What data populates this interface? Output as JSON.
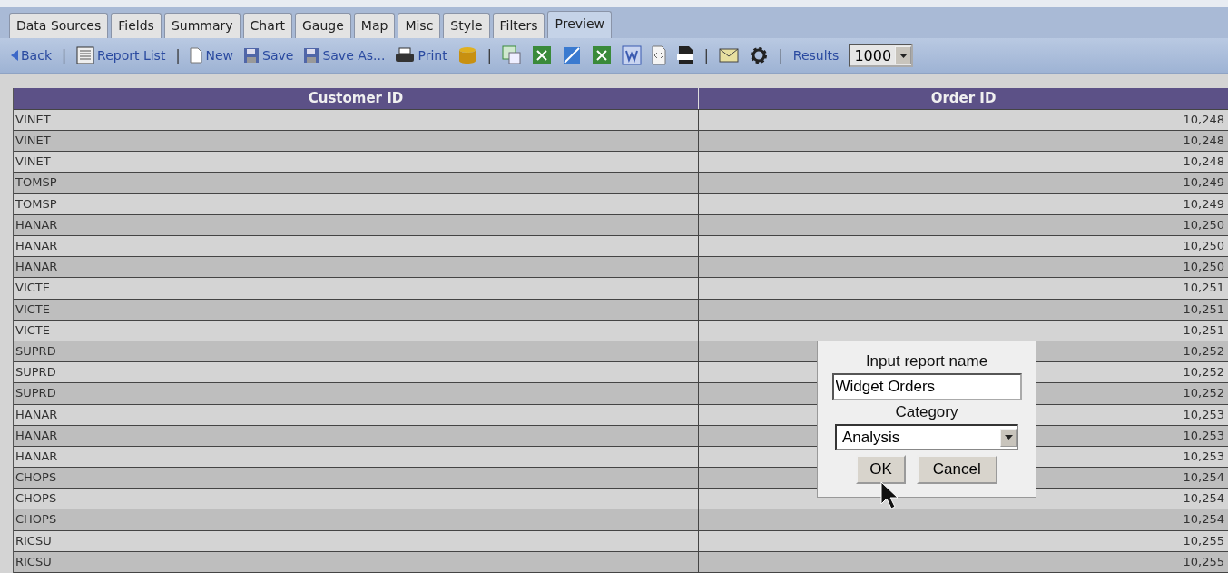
{
  "tabs": [
    {
      "label": "Data Sources",
      "selected": false
    },
    {
      "label": "Fields",
      "selected": false
    },
    {
      "label": "Summary",
      "selected": false
    },
    {
      "label": "Chart",
      "selected": false
    },
    {
      "label": "Gauge",
      "selected": false
    },
    {
      "label": "Map",
      "selected": false
    },
    {
      "label": "Misc",
      "selected": false
    },
    {
      "label": "Style",
      "selected": false
    },
    {
      "label": "Filters",
      "selected": false
    },
    {
      "label": "Preview",
      "selected": true
    }
  ],
  "toolbar": [
    {
      "kind": "text-button",
      "label": "Back"
    },
    {
      "kind": "separator",
      "label": "|"
    },
    {
      "kind": "text-button",
      "label": "Report List"
    },
    {
      "kind": "separator",
      "label": "|"
    },
    {
      "kind": "text-button",
      "label": "New"
    },
    {
      "kind": "text-button",
      "label": "Save"
    },
    {
      "kind": "text-button",
      "label": "Save As..."
    },
    {
      "kind": "text-button",
      "label": "Print"
    },
    {
      "kind": "icon-button"
    },
    {
      "kind": "separator",
      "label": "|"
    },
    {
      "kind": "icon-button"
    },
    {
      "kind": "icon-button"
    },
    {
      "kind": "icon-button"
    },
    {
      "kind": "icon-button"
    },
    {
      "kind": "icon-button"
    },
    {
      "kind": "icon-button"
    },
    {
      "kind": "icon-button"
    },
    {
      "kind": "separator",
      "label": "|"
    },
    {
      "kind": "icon-button"
    },
    {
      "kind": "icon-button"
    },
    {
      "kind": "separator",
      "label": "|"
    }
  ],
  "results": {
    "label": "Results",
    "value": "1000"
  },
  "table": {
    "columns": [
      "Customer ID",
      "Order ID"
    ],
    "rows": [
      [
        "VINET",
        "10,248"
      ],
      [
        "VINET",
        "10,248"
      ],
      [
        "VINET",
        "10,248"
      ],
      [
        "TOMSP",
        "10,249"
      ],
      [
        "TOMSP",
        "10,249"
      ],
      [
        "HANAR",
        "10,250"
      ],
      [
        "HANAR",
        "10,250"
      ],
      [
        "HANAR",
        "10,250"
      ],
      [
        "VICTE",
        "10,251"
      ],
      [
        "VICTE",
        "10,251"
      ],
      [
        "VICTE",
        "10,251"
      ],
      [
        "SUPRD",
        "10,252"
      ],
      [
        "SUPRD",
        "10,252"
      ],
      [
        "SUPRD",
        "10,252"
      ],
      [
        "HANAR",
        "10,253"
      ],
      [
        "HANAR",
        "10,253"
      ],
      [
        "HANAR",
        "10,253"
      ],
      [
        "CHOPS",
        "10,254"
      ],
      [
        "CHOPS",
        "10,254"
      ],
      [
        "CHOPS",
        "10,254"
      ],
      [
        "RICSU",
        "10,255"
      ],
      [
        "RICSU",
        "10,255"
      ]
    ]
  },
  "dialog": {
    "title": "Input report name",
    "name_value": "Widget Orders",
    "category_label": "Category",
    "category_value": "Analysis",
    "buttons": [
      "OK",
      "Cancel"
    ]
  }
}
